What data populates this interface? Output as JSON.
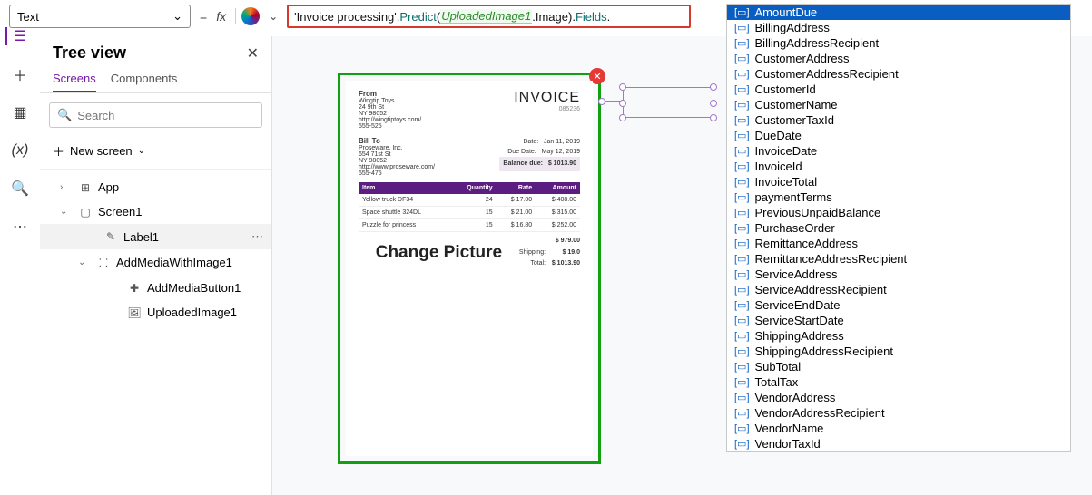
{
  "formulaBar": {
    "property": "Text",
    "eq": "=",
    "fx": "fx",
    "tokens": {
      "t1": "'Invoice processing'",
      "t2": ".",
      "t3": "Predict",
      "t4": "(",
      "t5": "UploadedImage1",
      "t6": ".Image).",
      "t7": "Fields",
      "t8": "."
    }
  },
  "railIcons": [
    "tree",
    "plus",
    "grid",
    "vars",
    "search",
    "more"
  ],
  "tree": {
    "title": "Tree view",
    "tabs": {
      "screens": "Screens",
      "components": "Components"
    },
    "search_placeholder": "Search",
    "new_screen": "New screen",
    "items": {
      "app": "App",
      "screen1": "Screen1",
      "label1": "Label1",
      "addmedia": "AddMediaWithImage1",
      "addmediabtn": "AddMediaButton1",
      "uploaded": "UploadedImage1"
    }
  },
  "invoice": {
    "title": "INVOICE",
    "number": "085236",
    "from_label": "From",
    "from": [
      "Wingtip Toys",
      "24 9th St",
      "NY 98052",
      "http://wingtiptoys.com/",
      "555-525"
    ],
    "billto_label": "Bill To",
    "billto": [
      "Proseware, Inc.",
      "654 71st St",
      "NY 98052",
      "http://www.proseware.com/",
      "555-475"
    ],
    "dates": {
      "date_l": "Date:",
      "date_v": "Jan 11, 2019",
      "due_l": "Due Date:",
      "due_v": "May 12, 2019"
    },
    "balance_l": "Balance due:",
    "balance_v": "$ 1013.90",
    "cols": [
      "Item",
      "Quantity",
      "Rate",
      "Amount"
    ],
    "rows": [
      [
        "Yellow truck DF34",
        "24",
        "$ 17.00",
        "$ 408.00"
      ],
      [
        "Space shuttle 324DL",
        "15",
        "$ 21.00",
        "$ 315.00"
      ],
      [
        "Puzzle for princess",
        "15",
        "$ 16.80",
        "$ 252.00"
      ]
    ],
    "change_picture": "Change Picture",
    "totals": {
      "sub_l": "",
      "sub_v": "$ 979.00",
      "ship_l": "Shipping:",
      "ship_v": "$ 19.0",
      "tot_l": "Total:",
      "tot_v": "$ 1013.90"
    }
  },
  "intellisense": {
    "selected": 0,
    "items": [
      "AmountDue",
      "BillingAddress",
      "BillingAddressRecipient",
      "CustomerAddress",
      "CustomerAddressRecipient",
      "CustomerId",
      "CustomerName",
      "CustomerTaxId",
      "DueDate",
      "InvoiceDate",
      "InvoiceId",
      "InvoiceTotal",
      "paymentTerms",
      "PreviousUnpaidBalance",
      "PurchaseOrder",
      "RemittanceAddress",
      "RemittanceAddressRecipient",
      "ServiceAddress",
      "ServiceAddressRecipient",
      "ServiceEndDate",
      "ServiceStartDate",
      "ShippingAddress",
      "ShippingAddressRecipient",
      "SubTotal",
      "TotalTax",
      "VendorAddress",
      "VendorAddressRecipient",
      "VendorName",
      "VendorTaxId"
    ]
  }
}
